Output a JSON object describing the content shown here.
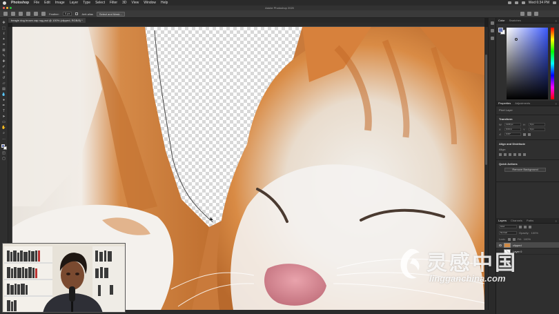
{
  "menubar": {
    "app": "Photoshop",
    "items": [
      "File",
      "Edit",
      "Image",
      "Layer",
      "Type",
      "Select",
      "Filter",
      "3D",
      "View",
      "Window",
      "Help"
    ],
    "clock": "Wed 6:34 PM"
  },
  "window": {
    "title": "Adobe Photoshop 2020"
  },
  "options": {
    "feather_label": "Feather:",
    "feather_value": "0 px",
    "antialias_label": "Anti-alias",
    "select_mask_button": "Select and Mask..."
  },
  "document": {
    "tab_label": "beagle dog brown cap rug.psd @ 100% (clipped, RGB/8) *"
  },
  "panels": {
    "color_tabs": [
      "Color",
      "Swatches"
    ],
    "properties_tabs": [
      "Properties",
      "Adjustments"
    ],
    "pixel_layer_label": "Pixel Layer",
    "transform_heading": "Transform",
    "w_value": "1140 px",
    "h_value": "0 px",
    "x_value": "0.04 in",
    "y_value": "0 px",
    "angle_value": "0.00°",
    "align_heading": "Align and Distribute",
    "align_sub": "Align:",
    "quick_heading": "Quick Actions",
    "remove_bg_button": "Remove Background",
    "layers_tabs": [
      "Layers",
      "Channels",
      "Paths"
    ],
    "kind_label": "Kind",
    "blend_mode": "Normal",
    "opacity_label": "Opacity:",
    "opacity_value": "100%",
    "lock_label": "Lock:",
    "fill_label": "Fill:",
    "fill_value": "100%",
    "layers": [
      {
        "name": "clipped",
        "selected": true
      },
      {
        "name": "Layer 0",
        "selected": false
      }
    ]
  },
  "colors": {
    "foreground": "#5f6fb0",
    "background": "#ffffff"
  },
  "watermark": {
    "cn": "灵感中国",
    "en": "lingganchina.com"
  },
  "icons": [
    "apple-logo",
    "move-tool",
    "marquee-tool",
    "lasso-tool",
    "magic-wand-tool",
    "crop-tool",
    "eyedropper-tool",
    "healing-tool",
    "brush-tool",
    "stamp-tool",
    "history-brush-tool",
    "eraser-tool",
    "gradient-tool",
    "blur-tool",
    "dodge-tool",
    "pen-tool",
    "type-tool",
    "path-select-tool",
    "shape-tool",
    "hand-tool",
    "zoom-tool",
    "more-tools",
    "eye-icon",
    "panel-menu-icon"
  ]
}
